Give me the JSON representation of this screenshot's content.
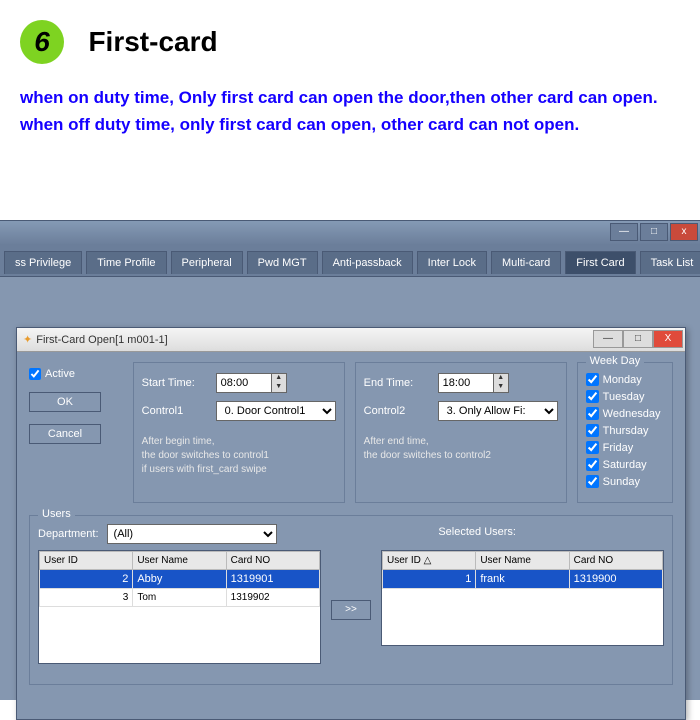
{
  "header": {
    "num": "6",
    "title": "First-card"
  },
  "desc": {
    "l1": "when on duty time, Only first card can open the door,then other card can open.",
    "l2": "when off duty time, only first card can open, other card can not open."
  },
  "outerWin": {
    "min": "—",
    "max": "□",
    "close": "x"
  },
  "tabs": [
    "ss Privilege",
    "Time Profile",
    "Peripheral",
    "Pwd MGT",
    "Anti-passback",
    "Inter Lock",
    "Multi-card",
    "First Card",
    "Task List"
  ],
  "activeTab": 7,
  "dialog": {
    "title": "First-Card Open[1   m001-1]",
    "min": "—",
    "max": "□",
    "close": "X",
    "activeLabel": "Active",
    "ok": "OK",
    "cancel": "Cancel",
    "startLabel": "Start Time:",
    "startVal": "08:00",
    "ctrl1Label": "Control1",
    "ctrl1Val": "0. Door Control1",
    "note1a": "After begin time,",
    "note1b": "the door switches to control1",
    "note1c": "if users with first_card  swipe",
    "endLabel": "End Time:",
    "endVal": "18:00",
    "ctrl2Label": "Control2",
    "ctrl2Val": "3. Only Allow Fi:",
    "note2a": "After end time,",
    "note2b": "the door switches to control2",
    "wkLabel": "Week Day",
    "days": [
      "Monday",
      "Tuesday",
      "Wednesday",
      "Thursday",
      "Friday",
      "Saturday",
      "Sunday"
    ]
  },
  "users": {
    "groupLabel": "Users",
    "deptLabel": "Department:",
    "deptVal": "(All)",
    "selLabel": "Selected Users:",
    "cols": [
      "User ID",
      "User Name",
      "Card NO"
    ],
    "colsR": [
      "User ID   △",
      "User Name",
      "Card NO"
    ],
    "left": [
      {
        "id": "2",
        "name": "Abby",
        "card": "1319901",
        "sel": true
      },
      {
        "id": "3",
        "name": "Tom",
        "card": "1319902",
        "sel": false
      }
    ],
    "right": [
      {
        "id": "1",
        "name": "frank",
        "card": "1319900",
        "sel": true
      }
    ],
    "moveBtn": ">>"
  }
}
